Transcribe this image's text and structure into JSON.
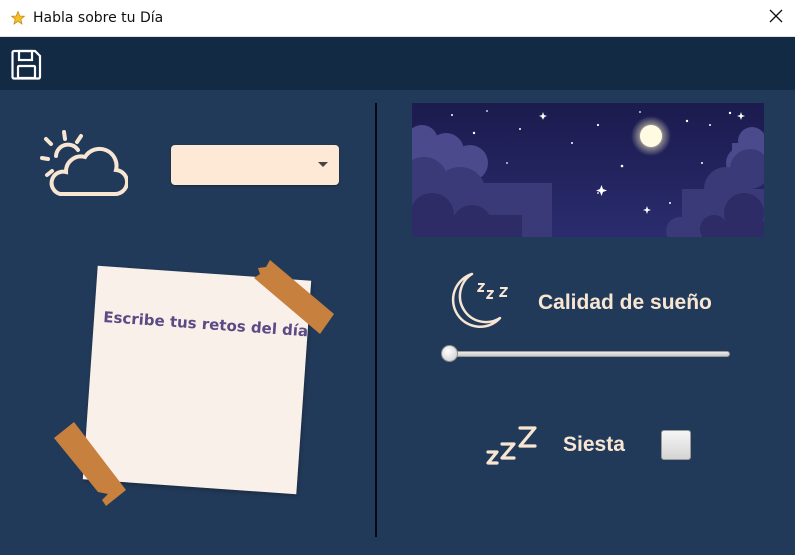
{
  "window": {
    "title": "Habla sobre tu Día",
    "app_icon": "star-icon",
    "close_icon": "close-icon"
  },
  "toolbar": {
    "save_icon": "floppy-disk-icon"
  },
  "weather": {
    "icon": "partly-cloudy-icon",
    "dropdown_value": ""
  },
  "challenges": {
    "note_text": "Escribe tus retos del día"
  },
  "night_banner": {
    "icon": "night-sky-moon-image"
  },
  "sleep": {
    "icon": "moon-zzz-icon",
    "label": "Calidad de sueño",
    "slider_value": 0
  },
  "nap": {
    "icon": "zzz-icon",
    "label": "Siesta",
    "checked": false
  },
  "colors": {
    "background": "#223a59",
    "toolbar": "#132a45",
    "accent_text": "#f8e6d2",
    "note_text": "#5a4a86",
    "tape": "#c8803e",
    "dropdown": "#fde9d6"
  }
}
